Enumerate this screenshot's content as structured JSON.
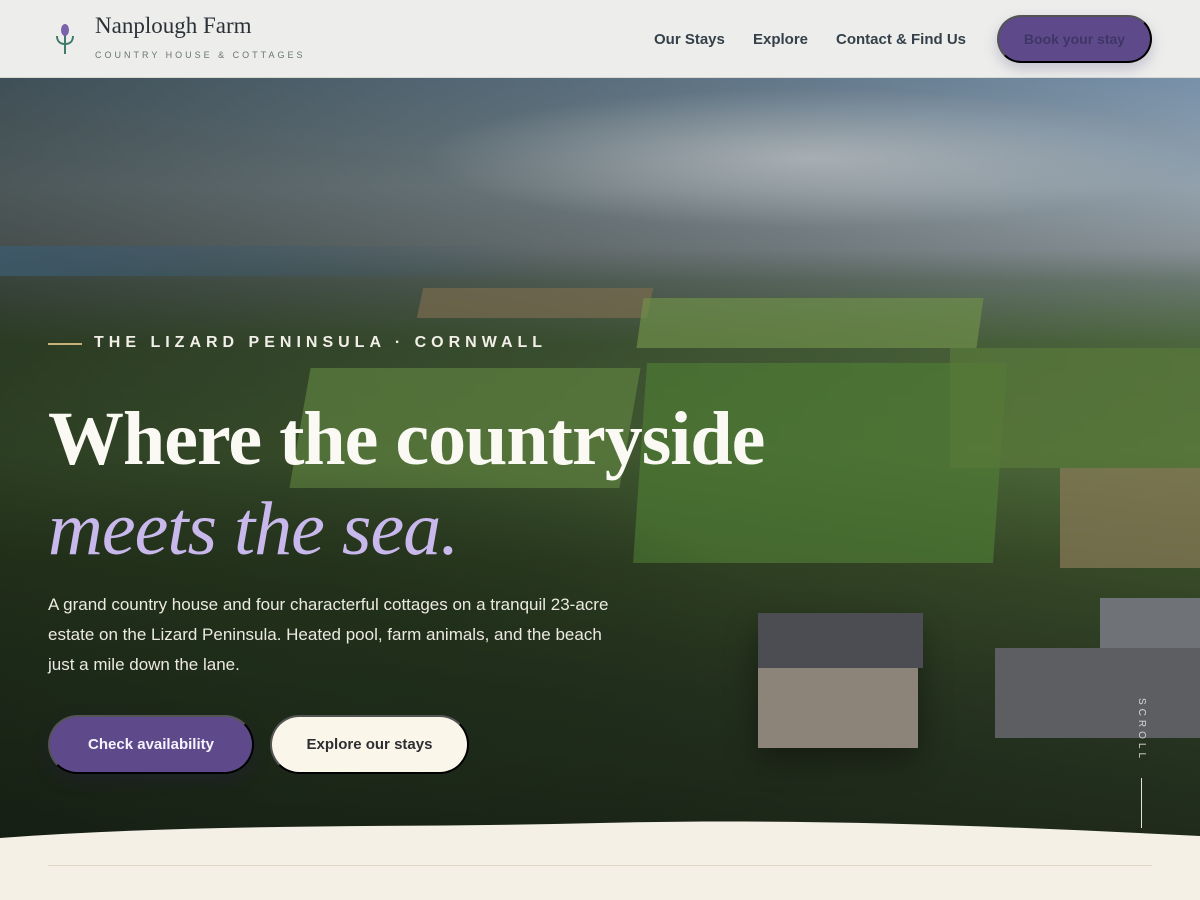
{
  "brand": {
    "name": "Nanplough Farm",
    "tagline": "COUNTRY HOUSE & COTTAGES",
    "logo_icon": "lavender-sprig-icon"
  },
  "nav": {
    "items": [
      {
        "label": "Our Stays"
      },
      {
        "label": "Explore"
      },
      {
        "label": "Contact & Find Us"
      }
    ],
    "cta": "Book your stay"
  },
  "hero": {
    "eyebrow": "THE LIZARD PENINSULA · CORNWALL",
    "headline_line1": "Where the countryside",
    "headline_line2": "meets the sea.",
    "description": "A grand country house and four characterful cottages on a tranquil 23-acre estate on the Lizard Peninsula. Heated pool, farm animals, and the beach just a mile down the lane.",
    "primary_button": "Check availability",
    "secondary_button": "Explore our stays",
    "scroll_label": "SCROLL"
  },
  "colors": {
    "accent": "#5e4a8a",
    "accent_light": "#c8b8ec",
    "cream": "#f4f0e6",
    "eyebrow_rule": "#c8b27a"
  }
}
